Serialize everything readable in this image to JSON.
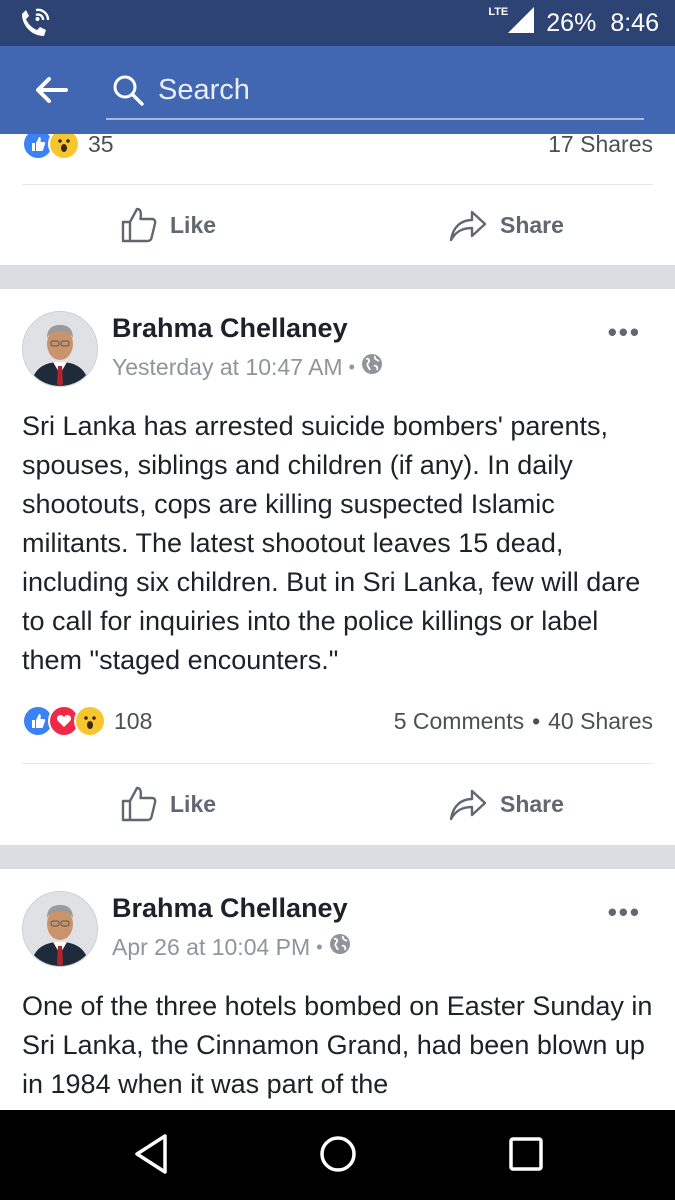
{
  "status_bar": {
    "network": "LTE",
    "battery": "26%",
    "time": "8:46",
    "icons": [
      "phone-wifi-icon",
      "signal-icon"
    ]
  },
  "search": {
    "placeholder": "Search"
  },
  "posts": [
    {
      "reactions": [
        "like",
        "wow"
      ],
      "reaction_count": "35",
      "shares": "17 Shares",
      "like_label": "Like",
      "share_label": "Share"
    },
    {
      "author": "Brahma Chellaney",
      "timestamp": "Yesterday at 10:47 AM",
      "privacy": "globe-icon",
      "text": "Sri Lanka has arrested suicide bombers' parents, spouses, siblings and children (if any). In daily shootouts, cops are killing suspected Islamic militants. The latest shootout leaves 15 dead, including six children. But in Sri Lanka, few will dare to call for inquiries into the police killings or label them \"staged encounters.\"",
      "reactions": [
        "like",
        "love",
        "wow"
      ],
      "reaction_count": "108",
      "comments": "5 Comments",
      "dot": "•",
      "shares": "40 Shares",
      "like_label": "Like",
      "share_label": "Share"
    },
    {
      "author": "Brahma Chellaney",
      "timestamp": "Apr 26 at 10:04 PM",
      "privacy": "globe-icon",
      "text": "One of the three hotels bombed on Easter Sunday in Sri Lanka, the Cinnamon Grand, had been blown up in 1984 when it was part of the"
    }
  ],
  "meta_separator": "•",
  "more_glyph": "•••",
  "nav_bar": [
    "back-triangle-icon",
    "home-circle-icon",
    "recents-square-icon"
  ],
  "colors": {
    "header": "#4267b2",
    "statusbar": "#2d4373",
    "like": "#3b82f6",
    "love": "#f0284a",
    "wow": "#f7c62f"
  }
}
